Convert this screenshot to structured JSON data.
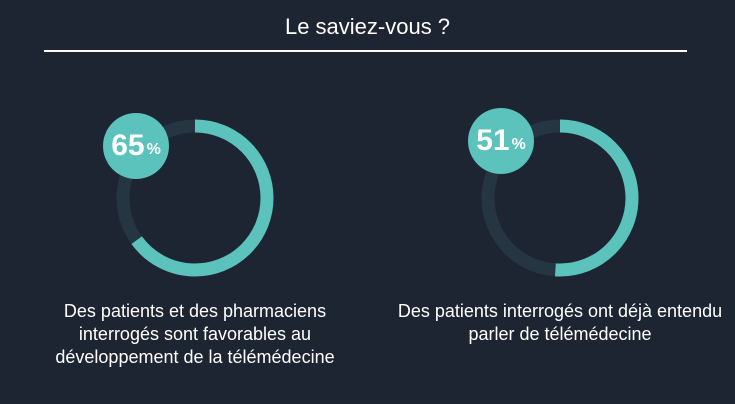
{
  "page": {
    "title": "Le saviez-vous ?"
  },
  "colors": {
    "background": "#1c2531",
    "accent": "#5bc2bc",
    "track": "#253642",
    "text": "#ffffff"
  },
  "chart_data": [
    {
      "type": "pie",
      "value": 65,
      "max": 100,
      "value_label": "65",
      "unit": "%",
      "description": "Des patients et des pharmaciens interrogés sont favorables au développement de la télémédecine"
    },
    {
      "type": "pie",
      "value": 51,
      "max": 100,
      "value_label": "51",
      "unit": "%",
      "description": "Des patients interrogés ont déjà entendu parler de télémédecine"
    }
  ]
}
